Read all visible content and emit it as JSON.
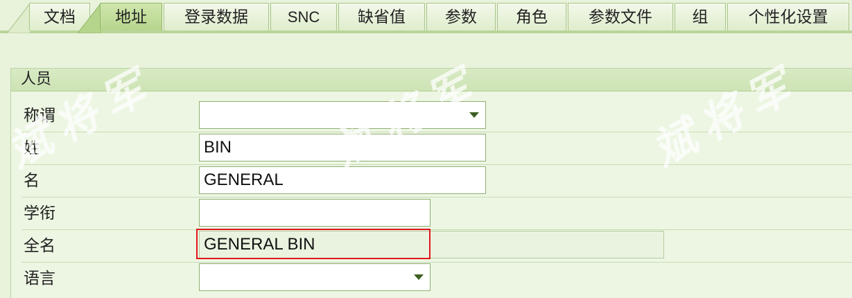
{
  "tabs": [
    {
      "label": "文档",
      "active": false
    },
    {
      "label": "地址",
      "active": true
    },
    {
      "label": "登录数据",
      "active": false
    },
    {
      "label": "SNC",
      "active": false
    },
    {
      "label": "缺省值",
      "active": false
    },
    {
      "label": "参数",
      "active": false
    },
    {
      "label": "角色",
      "active": false
    },
    {
      "label": "参数文件",
      "active": false
    },
    {
      "label": "组",
      "active": false
    },
    {
      "label": "个性化设置",
      "active": false
    }
  ],
  "group": {
    "title": "人员",
    "fields": {
      "salutation": {
        "label": "称谓",
        "value": ""
      },
      "last_name": {
        "label": "姓",
        "value": "BIN"
      },
      "first_name": {
        "label": "名",
        "value": "GENERAL"
      },
      "academic_title": {
        "label": "学衔",
        "value": ""
      },
      "full_name": {
        "label": "全名",
        "value": "GENERAL BIN"
      },
      "language": {
        "label": "语言",
        "value": ""
      }
    }
  },
  "watermark": "斌将军",
  "colors": {
    "highlight": "#e0161b",
    "active_tab": "#b6d58c",
    "background": "#e9f3dc"
  }
}
